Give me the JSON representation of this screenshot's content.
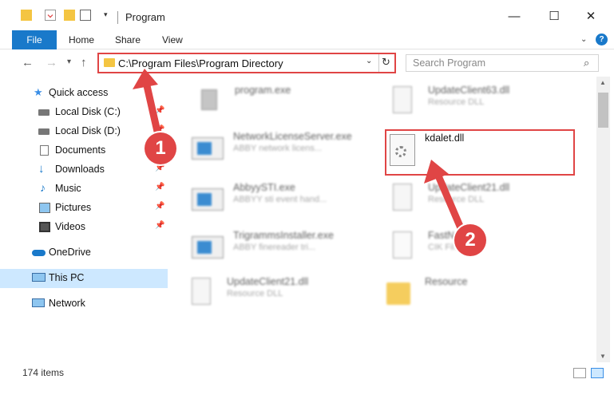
{
  "window": {
    "title": "Program",
    "controls": {
      "minimize": "—",
      "maximize": "☐",
      "close": "✕"
    }
  },
  "ribbon": {
    "tabs": [
      {
        "label": "File",
        "active": true
      },
      {
        "label": "Home"
      },
      {
        "label": "Share"
      },
      {
        "label": "View"
      }
    ],
    "help": "?"
  },
  "address": {
    "path": "C:\\Program Files\\Program Directory",
    "search_placeholder": "Search Program"
  },
  "sidebar": {
    "items": [
      {
        "label": "Quick access",
        "icon": "star-icon",
        "pinned": false
      },
      {
        "label": "Local Disk (C:)",
        "icon": "drive-icon",
        "pinned": true
      },
      {
        "label": "Local Disk (D:)",
        "icon": "drive-icon",
        "pinned": true
      },
      {
        "label": "Documents",
        "icon": "document-icon",
        "pinned": true
      },
      {
        "label": "Downloads",
        "icon": "download-icon",
        "pinned": true
      },
      {
        "label": "Music",
        "icon": "music-icon",
        "pinned": true
      },
      {
        "label": "Pictures",
        "icon": "pictures-icon",
        "pinned": true
      },
      {
        "label": "Videos",
        "icon": "videos-icon",
        "pinned": true
      },
      {
        "label": "OneDrive",
        "icon": "cloud-icon",
        "pinned": false
      },
      {
        "label": "This PC",
        "icon": "computer-icon",
        "pinned": false,
        "selected": true
      },
      {
        "label": "Network",
        "icon": "network-icon",
        "pinned": false
      }
    ]
  },
  "files": [
    {
      "name": "program.exe",
      "desc": "",
      "icon": "program-exe-icon",
      "blurred": true
    },
    {
      "name": "UpdateClient63.dll",
      "desc": "Resource DLL",
      "icon": "dll-icon",
      "blurred": true
    },
    {
      "name": "NetworkLicenseServer.exe",
      "desc": "ABBY network licens...",
      "icon": "app-window-icon",
      "blurred": true
    },
    {
      "name": "kdalet.dll",
      "desc": "",
      "icon": "dll-gear-icon",
      "blurred": false
    },
    {
      "name": "AbbyySTI.exe",
      "desc": "ABBYY sti event hand...",
      "icon": "app-window-icon",
      "blurred": true
    },
    {
      "name": "UpdateClient21.dll",
      "desc": "Resource DLL",
      "icon": "dll-icon",
      "blurred": true
    },
    {
      "name": "TrigrammsInstaller.exe",
      "desc": "ABBY finereader tri...",
      "icon": "app-window-icon",
      "blurred": true
    },
    {
      "name": "FastN...",
      "desc": "CIK Fil...",
      "icon": "file-icon",
      "blurred": true
    },
    {
      "name": "UpdateClient21.dll",
      "desc": "Resource DLL",
      "icon": "dll-icon",
      "blurred": true
    },
    {
      "name": "Resource",
      "desc": "",
      "icon": "folder-icon",
      "blurred": true
    }
  ],
  "status": {
    "item_count": "174 items"
  },
  "annotations": {
    "badge1": "1",
    "badge2": "2"
  },
  "colors": {
    "accent": "#1979ca",
    "highlight": "#e04545",
    "selected": "#cde8ff",
    "folder": "#f4c542"
  }
}
